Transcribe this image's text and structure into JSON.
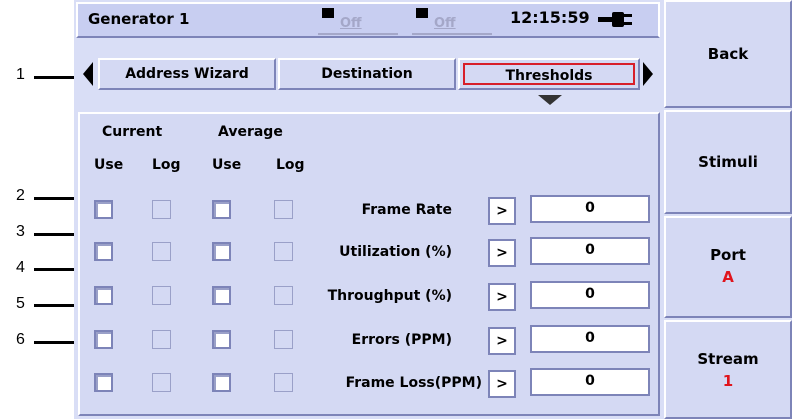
{
  "callouts": [
    "1",
    "2",
    "3",
    "4",
    "5",
    "6"
  ],
  "header": {
    "title": "Generator 1",
    "status1": "Off",
    "status2": "Off",
    "time": "12:15:59"
  },
  "tabs": [
    {
      "label": "Address Wizard",
      "active": false
    },
    {
      "label": "Destination",
      "active": false
    },
    {
      "label": "Thresholds",
      "active": true
    }
  ],
  "columns": {
    "current": "Current",
    "average": "Average",
    "use": "Use",
    "log": "Log"
  },
  "rows": [
    {
      "label": "Frame Rate",
      "value": "0"
    },
    {
      "label": "Utilization (%)",
      "value": "0"
    },
    {
      "label": "Throughput (%)",
      "value": "0"
    },
    {
      "label": "Errors (PPM)",
      "value": "0"
    },
    {
      "label": "Frame Loss(PPM)",
      "value": "0"
    }
  ],
  "arrow_label": ">",
  "sidebar": {
    "back": "Back",
    "stimuli": "Stimuli",
    "port": "Port",
    "port_value": "A",
    "stream": "Stream",
    "stream_value": "1"
  },
  "colors": {
    "accent_red": "#d81f2a",
    "panel": "#d4d9f3",
    "border_dark": "#7d84b8"
  }
}
